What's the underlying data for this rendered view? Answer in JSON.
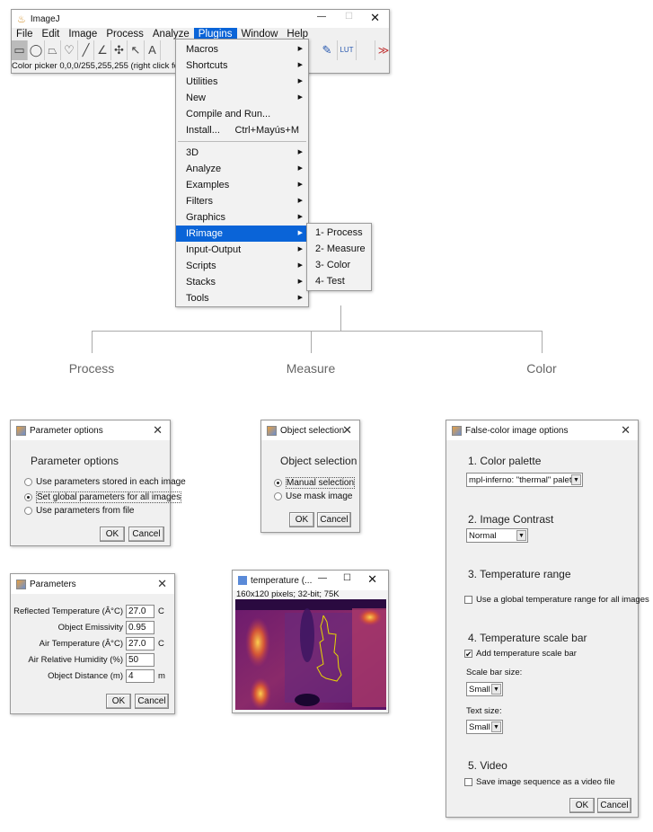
{
  "imagej": {
    "title": "ImageJ",
    "menu": [
      "File",
      "Edit",
      "Image",
      "Process",
      "Analyze",
      "Plugins",
      "Window",
      "Help"
    ],
    "tools": [
      "rectangle-icon",
      "oval-icon",
      "polygon-icon",
      "freehand-icon",
      "line-icon",
      "angle-icon",
      "multipoint-icon",
      "wand-icon",
      "text-icon"
    ],
    "right_tools": {
      "picker": "color-picker-icon",
      "lut": "LUT",
      "more": "≫"
    },
    "status": "Color picker 0,0,0/255,255,255 (right click for"
  },
  "plugins_menu": {
    "items": [
      {
        "label": "Macros",
        "sub": true
      },
      {
        "label": "Shortcuts",
        "sub": true
      },
      {
        "label": "Utilities",
        "sub": true
      },
      {
        "label": "New",
        "sub": true
      },
      {
        "label": "Compile and Run...",
        "sub": false
      },
      {
        "label": "Install...",
        "sub": false,
        "shortcut": "Ctrl+Mayús+M"
      },
      {
        "label": "3D",
        "sub": true
      },
      {
        "label": "Analyze",
        "sub": true
      },
      {
        "label": "Examples",
        "sub": true
      },
      {
        "label": "Filters",
        "sub": true
      },
      {
        "label": "Graphics",
        "sub": true
      },
      {
        "label": "IRimage",
        "sub": true,
        "highlighted": true
      },
      {
        "label": "Input-Output",
        "sub": true
      },
      {
        "label": "Scripts",
        "sub": true
      },
      {
        "label": "Stacks",
        "sub": true
      },
      {
        "label": "Tools",
        "sub": true
      }
    ],
    "irimage_submenu": [
      "1- Process",
      "2- Measure",
      "3- Color",
      "4- Test"
    ]
  },
  "branches": [
    "Process",
    "Measure",
    "Color"
  ],
  "parameter_options": {
    "title": "Parameter options",
    "heading": "Parameter options",
    "options": [
      "Use parameters stored in each image",
      "Set global parameters for all images",
      "Use parameters from file"
    ],
    "selected": 1,
    "ok": "OK",
    "cancel": "Cancel"
  },
  "parameters": {
    "title": "Parameters",
    "fields": [
      {
        "label": "Reflected Temperature (Â°C)",
        "value": "27.0",
        "unit": "C"
      },
      {
        "label": "Object Emissivity",
        "value": "0.95",
        "unit": ""
      },
      {
        "label": "Air Temperature (Â°C)",
        "value": "27.0",
        "unit": "C"
      },
      {
        "label": "Air Relative Humidity (%)",
        "value": "50",
        "unit": ""
      },
      {
        "label": "Object Distance (m)",
        "value": "4",
        "unit": "m"
      }
    ],
    "ok": "OK",
    "cancel": "Cancel"
  },
  "object_selection": {
    "title": "Object selection",
    "heading": "Object selection",
    "options": [
      "Manual selection",
      "Use mask image"
    ],
    "selected": 0,
    "ok": "OK",
    "cancel": "Cancel"
  },
  "image_window": {
    "title": "temperature (...",
    "info": "160x120 pixels; 32-bit; 75K",
    "roi_color": "#e8d800"
  },
  "false_color": {
    "title": "False-color image options",
    "s1": "1. Color palette",
    "palette": "mpl-inferno: \"thermal\" palette",
    "s2": "2. Image Contrast",
    "contrast": "Normal",
    "s3": "3. Temperature range",
    "global_range": "Use a global temperature range for all images",
    "global_range_checked": false,
    "s4": "4. Temperature scale bar",
    "add_bar": "Add temperature scale bar",
    "add_bar_checked": true,
    "bar_size_label": "Scale bar size:",
    "bar_size": "Small",
    "text_size_label": "Text size:",
    "text_size": "Small",
    "s5": "5. Video",
    "video": "Save image sequence as a video file",
    "video_checked": false,
    "ok": "OK",
    "cancel": "Cancel"
  }
}
